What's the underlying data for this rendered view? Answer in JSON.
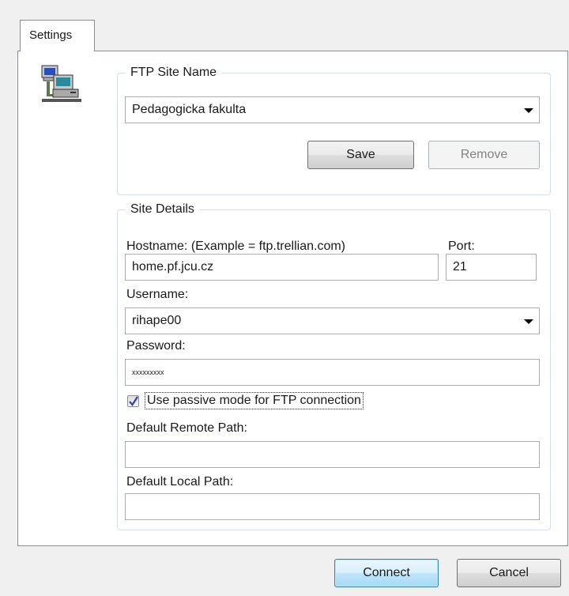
{
  "tabs": [
    {
      "label": "Settings"
    }
  ],
  "site_name_group": {
    "title": "FTP Site Name",
    "selected_site": "Pedagogicka fakulta",
    "save_label": "Save",
    "remove_label": "Remove"
  },
  "details_group": {
    "title": "Site Details",
    "hostname_label": "Hostname: (Example = ftp.trellian.com)",
    "hostname_value": "home.pf.jcu.cz",
    "port_label": "Port:",
    "port_value": "21",
    "username_label": "Username:",
    "username_value": "rihape00",
    "password_label": "Password:",
    "password_value": "xxxxxxxxx",
    "passive_mode_label": "Use passive mode for FTP connection",
    "passive_mode_checked": true,
    "remote_path_label": "Default Remote Path:",
    "remote_path_value": "",
    "local_path_label": "Default Local Path:",
    "local_path_value": ""
  },
  "footer": {
    "connect_label": "Connect",
    "cancel_label": "Cancel"
  },
  "icons": {
    "site_icon": "network-computers-icon",
    "dropdown": "chevron-down-icon",
    "check": "checkmark-icon"
  },
  "colors": {
    "default_button_border": "#3c7fb1",
    "check_color": "#3a4a9c",
    "dialog_background": "#f0f0f0"
  }
}
